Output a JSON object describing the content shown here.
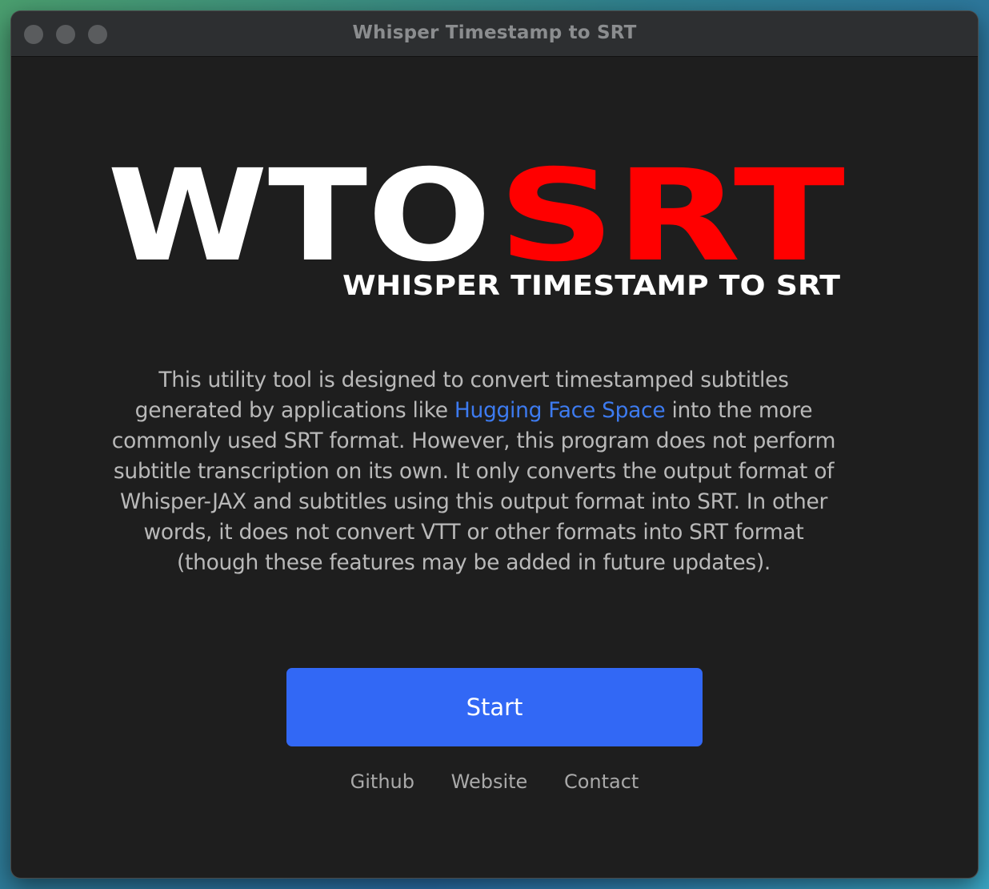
{
  "window": {
    "title": "Whisper Timestamp to SRT"
  },
  "logo": {
    "part1": "WTO",
    "part2": "SRT",
    "subtitle": "WHISPER TIMESTAMP TO SRT",
    "colors": {
      "light": "#ffffff",
      "accent": "#ff0000"
    }
  },
  "description": {
    "before_link": "This utility tool is designed to convert timestamped subtitles generated by applications like ",
    "link_text": "Hugging Face Space",
    "after_link": " into the more commonly used SRT format. However, this program does not perform subtitle transcription on its own. It only converts the output format of Whisper-JAX and subtitles using this output format into SRT. In other words, it does not convert VTT or other formats into SRT format (though these features may be added in future updates)."
  },
  "start_button": {
    "label": "Start",
    "color": "#3268f5"
  },
  "footer": {
    "links": [
      "Github",
      "Website",
      "Contact"
    ]
  }
}
